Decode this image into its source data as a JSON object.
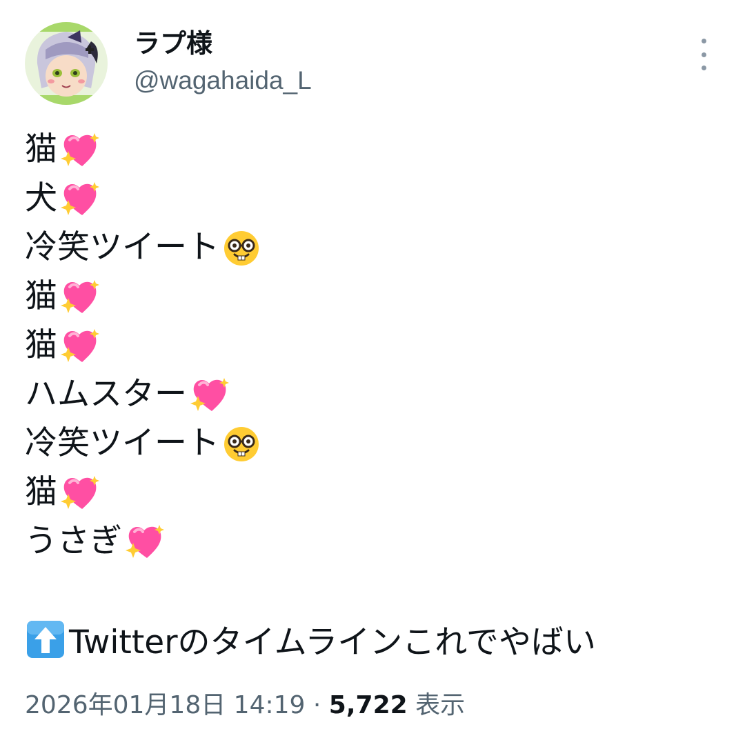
{
  "author": {
    "display_name": "ラプ様",
    "handle": "@wagahaida_L"
  },
  "tweet": {
    "lines": [
      {
        "text": "猫",
        "emoji": "sparkling-heart"
      },
      {
        "text": "犬",
        "emoji": "sparkling-heart"
      },
      {
        "text": "冷笑ツイート",
        "emoji": "nerd-face"
      },
      {
        "text": "猫",
        "emoji": "sparkling-heart"
      },
      {
        "text": "猫",
        "emoji": "sparkling-heart"
      },
      {
        "text": "ハムスター",
        "emoji": "sparkling-heart"
      },
      {
        "text": "冷笑ツイート",
        "emoji": "nerd-face"
      },
      {
        "text": "猫",
        "emoji": "sparkling-heart"
      },
      {
        "text": "うさぎ",
        "emoji": "sparkling-heart"
      }
    ],
    "final_emoji": "up-arrow",
    "final_text": "Twitterのタイムラインこれでやばい"
  },
  "meta": {
    "timestamp": "2026年01月18日 14:19",
    "separator": "·",
    "views_count": "5,722",
    "views_label": "表示"
  },
  "colors": {
    "text_primary": "#0f1419",
    "text_secondary": "#536471",
    "heart_pink": "#ff4fa3",
    "emoji_yellow": "#ffcc33",
    "arrow_blue": "#3aa0e8"
  }
}
